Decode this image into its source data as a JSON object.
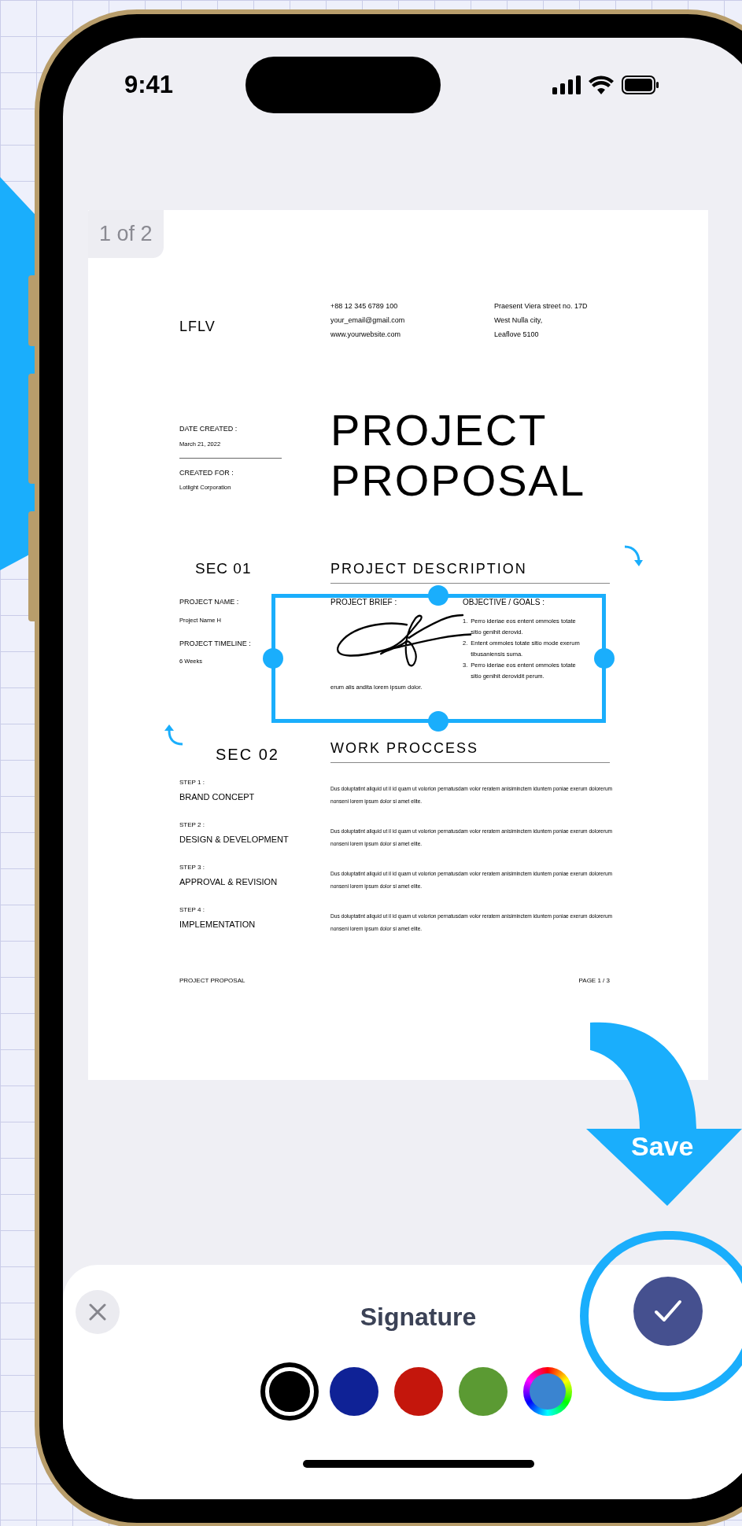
{
  "status_bar": {
    "time": "9:41"
  },
  "document": {
    "page_badge": "1 of 2",
    "logo": "LFLV",
    "contact": [
      "+88 12 345 6789 100",
      "your_email@gmail.com",
      "www.yourwebsite.com"
    ],
    "address": [
      "Praesent Viera street no. 17D",
      "West Nulla city,",
      "Leaflove 5100"
    ],
    "meta": [
      {
        "label": "DATE CREATED :",
        "value": "March 21, 2022"
      },
      {
        "label": "CREATED FOR :",
        "value": "Lotlight Corporation"
      }
    ],
    "title_lines": [
      "PROJECT",
      "PROPOSAL"
    ],
    "sec1": {
      "heading": "SEC 01",
      "fields": [
        {
          "label": "PROJECT NAME :",
          "value": "Project Name H"
        },
        {
          "label": "PROJECT TIMELINE :",
          "value": "6 Weeks"
        }
      ]
    },
    "description": {
      "heading": "PROJECT DESCRIPTION",
      "brief_label": "PROJECT BRIEF :",
      "brief": "erum alis andita lorem ipsum dolor.",
      "goals_label": "OBJECTIVE / GOALS :",
      "goals": [
        {
          "num": "1.",
          "text": "Perro ideriae eos entent ommoles totate sitio genihit derovid."
        },
        {
          "num": "2.",
          "text": "Entent ommoles totate sitio mode exerum tibusaniensis suma."
        },
        {
          "num": "3.",
          "text": "Perro ideriae eos entent ommoles totate sitio genihit derovidit perum."
        }
      ]
    },
    "sec2": {
      "heading": "SEC 02"
    },
    "work_heading": "WORK PROCCESS",
    "steps": [
      {
        "step": "STEP 1 :",
        "title": "BRAND CONCEPT",
        "text": "Dus doluptatint aliquid ut il id quam ut volorion pernatusdam volor reratem anisiminctem iduntem poniae exerum dolorerum nonseni lorem ipsum dolor si amet elite."
      },
      {
        "step": "STEP 2 :",
        "title": "DESIGN & DEVELOPMENT",
        "text": "Dus doluptatint aliquid ut il id quam ut volorion pernatusdam volor reratem anisiminctem iduntem poniae exerum dolorerum nonseni lorem ipsum dolor si amet elite."
      },
      {
        "step": "STEP 3 :",
        "title": "APPROVAL & REVISION",
        "text": "Dus doluptatint aliquid ut il id quam ut volorion pernatusdam volor reratem anisiminctem iduntem poniae exerum dolorerum nonseni lorem ipsum dolor si amet elite."
      },
      {
        "step": "STEP 4 :",
        "title": "IMPLEMENTATION",
        "text": "Dus doluptatint aliquid ut il id quam ut volorion pernatusdam volor reratem anisiminctem iduntem poniae exerum dolorerum nonseni lorem ipsum dolor si amet elite."
      }
    ],
    "footer_left": "PROJECT PROPOSAL",
    "footer_right": "PAGE 1 / 3"
  },
  "callout": {
    "label": "Save"
  },
  "sheet": {
    "title": "Signature",
    "colors": [
      {
        "kind": "swatch",
        "color": "#000000",
        "selected": true
      },
      {
        "kind": "swatch",
        "color": "#0f2296",
        "selected": false
      },
      {
        "kind": "swatch",
        "color": "#c4160c",
        "selected": false
      },
      {
        "kind": "swatch",
        "color": "#5b9a33",
        "selected": false
      },
      {
        "kind": "picker",
        "color": "#3a84d0",
        "selected": false
      }
    ]
  }
}
